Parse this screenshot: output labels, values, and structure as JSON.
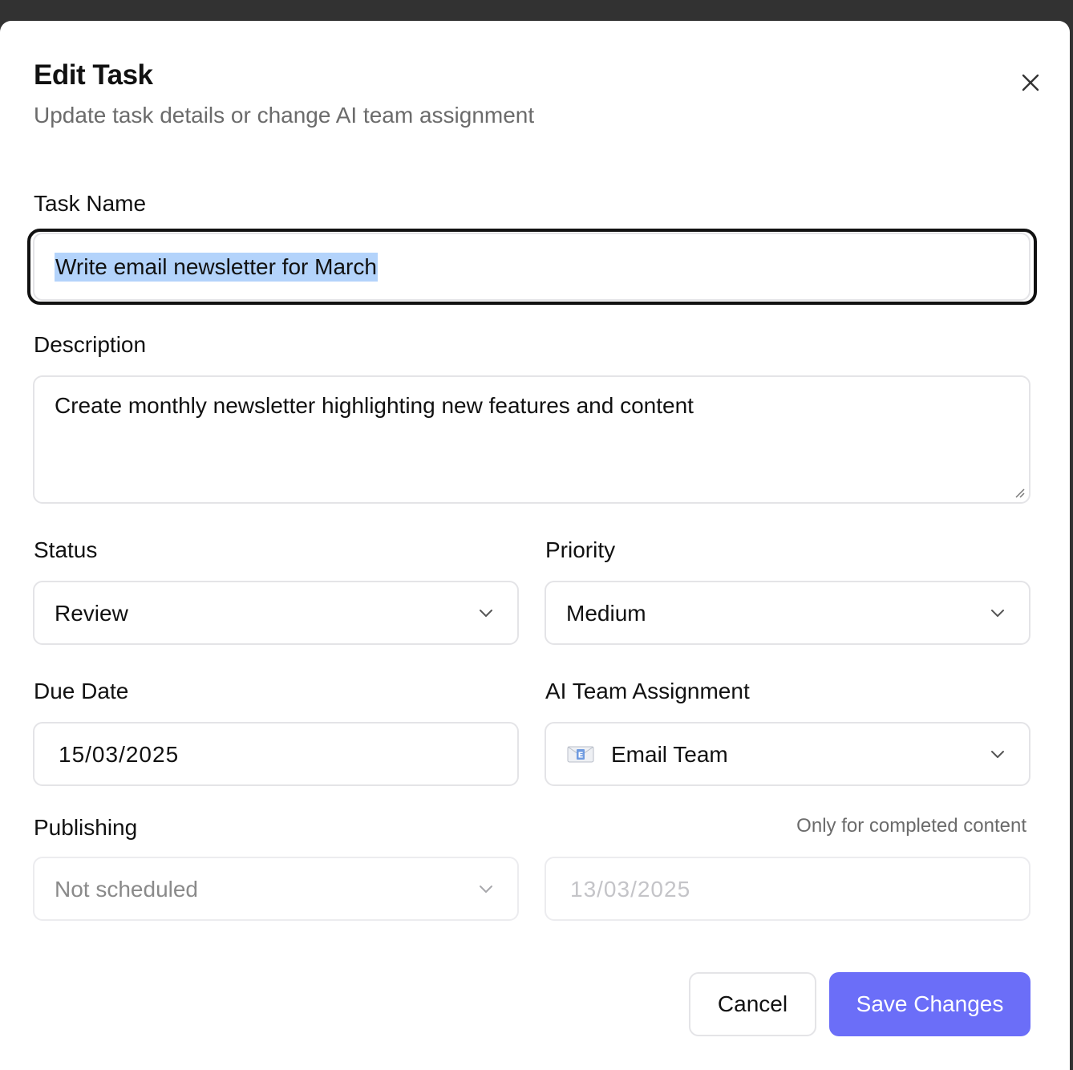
{
  "dialog": {
    "title": "Edit Task",
    "subtitle": "Update task details or change AI team assignment"
  },
  "task_name": {
    "label": "Task Name",
    "value": "Write email newsletter for March"
  },
  "description": {
    "label": "Description",
    "value": "Create monthly newsletter highlighting new features and content"
  },
  "status": {
    "label": "Status",
    "value": "Review"
  },
  "priority": {
    "label": "Priority",
    "value": "Medium"
  },
  "due_date": {
    "label": "Due Date",
    "value": "15/03/2025"
  },
  "ai_team": {
    "label": "AI Team Assignment",
    "value": "Email Team",
    "icon": "email-envelope-icon"
  },
  "publishing": {
    "label": "Publishing",
    "hint": "Only for completed content",
    "value": "Not scheduled",
    "date_value": "13/03/2025"
  },
  "actions": {
    "cancel_label": "Cancel",
    "save_label": "Save Changes"
  },
  "colors": {
    "accent": "#6b6ef8",
    "selection": "#b3d3fb",
    "overlay": "#323232"
  }
}
